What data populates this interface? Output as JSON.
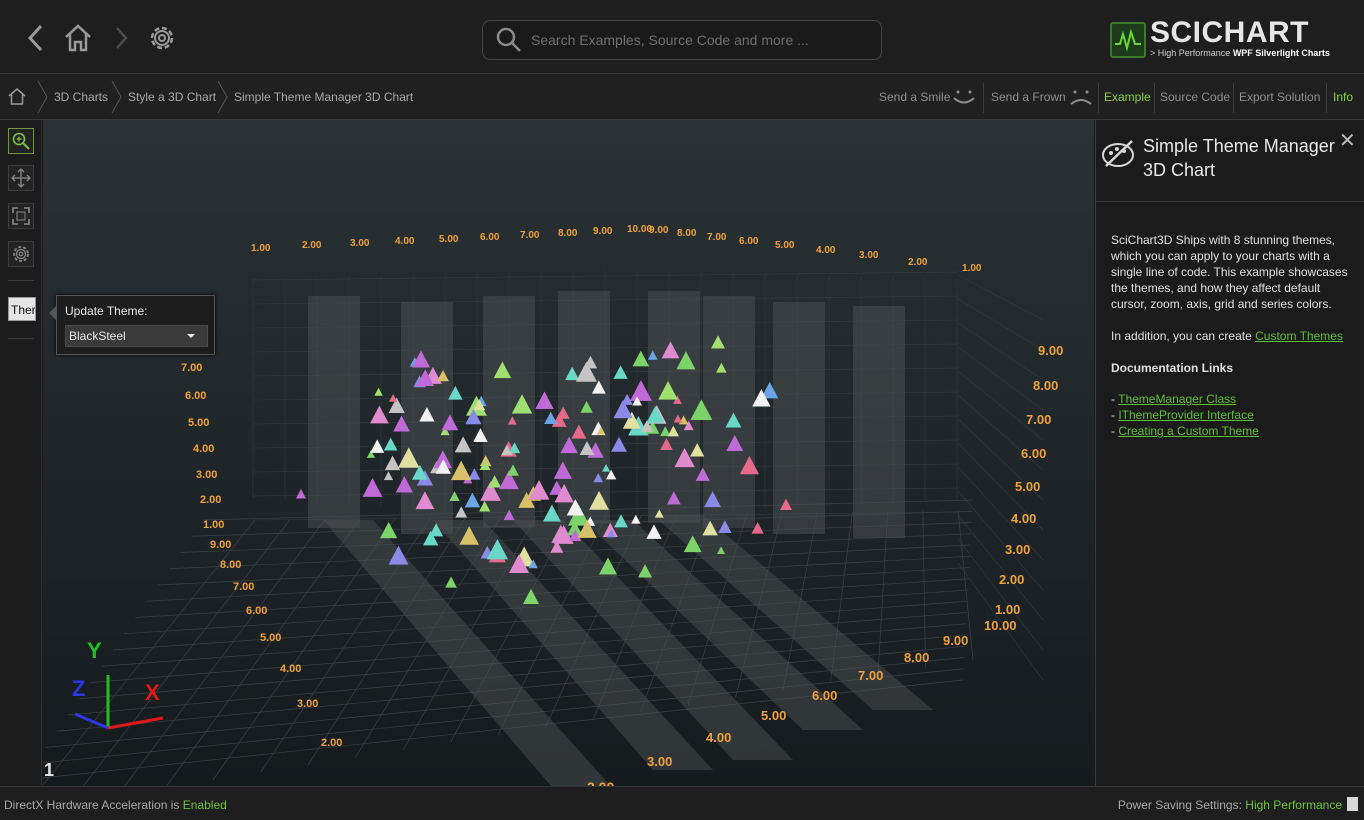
{
  "topbar": {
    "search_placeholder": "Search Examples, Source Code and more ...",
    "logo_text": "SCICHART",
    "logo_sub_prefix": "> High Performance",
    "logo_sub_bold": "WPF Silverlight Charts",
    "icons": [
      "back-icon",
      "home-icon",
      "forward-icon",
      "settings-icon",
      "search-icon"
    ]
  },
  "breadcrumb": {
    "items": [
      "3D Charts",
      "Style a 3D Chart",
      "Simple Theme Manager 3D Chart"
    ],
    "actions": {
      "smile": "Send a Smile",
      "frown": "Send a Frown",
      "example": "Example",
      "source": "Source Code",
      "export": "Export Solution",
      "info": "Info"
    }
  },
  "toolbar": {
    "theme_tab": "Ther",
    "tools": [
      "zoom-icon",
      "pan-icon",
      "zoom-extents-icon",
      "settings-icon"
    ]
  },
  "theme_popup": {
    "title": "Update Theme:",
    "selected": "BlackSteel"
  },
  "chart": {
    "axis_labels": {
      "y": "Y",
      "z": "Z",
      "x": "X"
    },
    "corner_label": "1",
    "colors": {
      "tick": "#f0a23a",
      "y_axis": "#20c020",
      "x_axis": "#e01818",
      "z_axis": "#2a3ae0"
    }
  },
  "info_panel": {
    "title": "Simple Theme Manager 3D Chart",
    "paragraph1": "SciChart3D Ships with 8 stunning themes, which you can apply to your charts with a single line of code. This example showcases the themes, and how they affect default cursor, zoom, axis, grid and series colors.",
    "paragraph2_prefix": "In addition, you can create",
    "paragraph2_link": "Custom Themes",
    "docs_heading": "Documentation Links",
    "links": [
      "ThemeManager Class",
      "IThemeProvider Interface",
      "Creating a Custom Theme"
    ]
  },
  "status": {
    "left_prefix": "DirectX Hardware Acceleration is",
    "left_value": "Enabled",
    "right_prefix": "Power Saving Settings:",
    "right_value": "High Performance"
  }
}
